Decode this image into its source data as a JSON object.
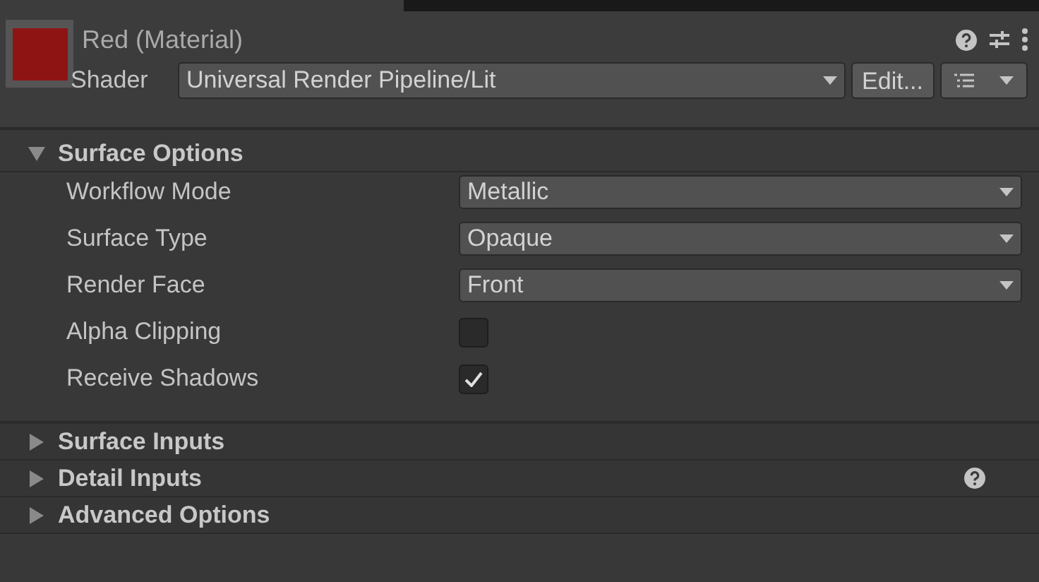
{
  "header": {
    "title": "Red (Material)",
    "shader_label": "Shader",
    "shader": "Universal Render Pipeline/Lit",
    "edit_button": "Edit..."
  },
  "sections": [
    {
      "title": "Surface Options",
      "expanded": true,
      "help": false,
      "rows": [
        {
          "kind": "dropdown",
          "label": "Workflow Mode",
          "value": "Metallic"
        },
        {
          "kind": "dropdown",
          "label": "Surface Type",
          "value": "Opaque"
        },
        {
          "kind": "dropdown",
          "label": "Render Face",
          "value": "Front"
        },
        {
          "kind": "checkbox",
          "label": "Alpha Clipping",
          "checked": false
        },
        {
          "kind": "checkbox",
          "label": "Receive Shadows",
          "checked": true
        }
      ]
    },
    {
      "title": "Surface Inputs",
      "expanded": false,
      "help": false
    },
    {
      "title": "Detail Inputs",
      "expanded": false,
      "help": true
    },
    {
      "title": "Advanced Options",
      "expanded": false,
      "help": false
    }
  ]
}
